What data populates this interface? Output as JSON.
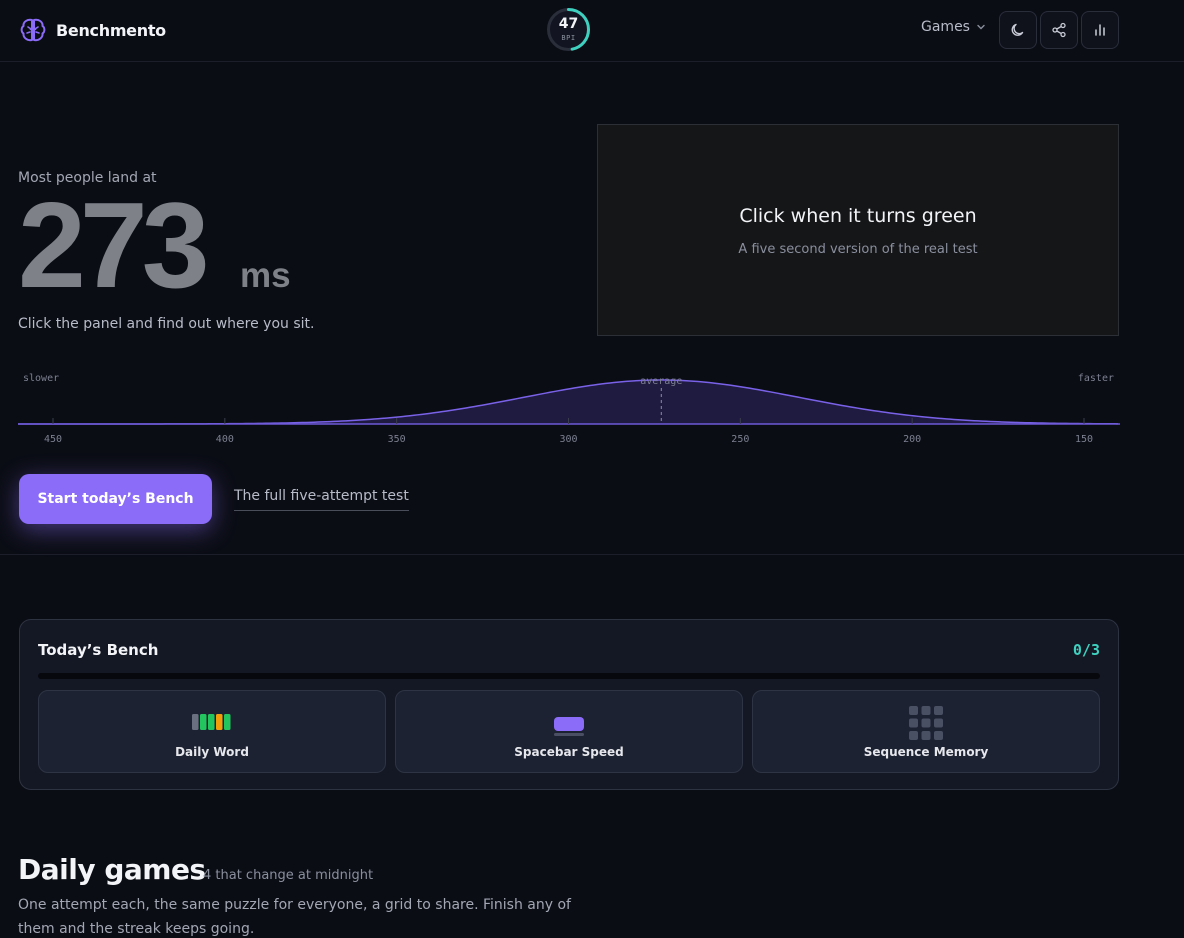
{
  "header": {
    "brand": "Benchmento",
    "bpi": {
      "value": "47",
      "label": "BPI"
    },
    "games_menu": "Games",
    "icons": [
      "brain-logo-icon",
      "chevron-down-icon",
      "moon-icon",
      "share-icon",
      "bar-chart-icon"
    ]
  },
  "hero": {
    "eyebrow": "Most people land at",
    "value": "273",
    "unit": "ms",
    "subtitle": "Click the panel and find out where you sit."
  },
  "panel": {
    "title": "Click when it turns green",
    "subtitle": "A five second version of the real test"
  },
  "distribution": {
    "left_label": "slower",
    "center_label": "average",
    "right_label": "faster",
    "ticks": [
      "450",
      "400",
      "350",
      "300",
      "250",
      "200",
      "150"
    ],
    "mean_ms": 273
  },
  "cta": {
    "primary": "Start today’s Bench",
    "secondary": "The full five-attempt test"
  },
  "bench": {
    "title": "Today’s Bench",
    "count": "0/3",
    "progress": 0,
    "tiles": [
      {
        "label": "Daily Word",
        "icon": "letter-tiles-icon"
      },
      {
        "label": "Spacebar Speed",
        "icon": "spacebar-icon"
      },
      {
        "label": "Sequence Memory",
        "icon": "grid-icon"
      }
    ]
  },
  "daily_games": {
    "title": "Daily games",
    "meta": "4 that change at midnight",
    "description": "One attempt each, the same puzzle for everyone, a grid to share. Finish any of them and the streak keeps going."
  },
  "colors": {
    "background": "#0b0d15",
    "accent": "#8b6cf9",
    "teal": "#3fd1c0",
    "card": "#141824"
  }
}
